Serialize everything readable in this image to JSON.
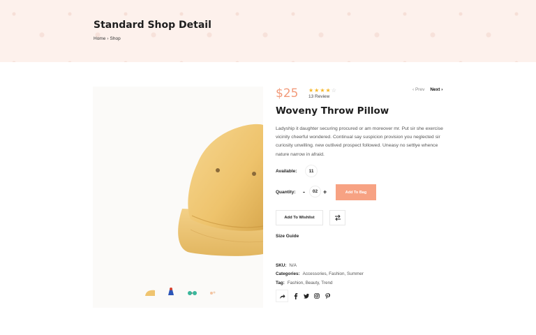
{
  "banner": {
    "title": "Standard Shop Detail",
    "breadcrumb": {
      "home": "Home",
      "separator": "›",
      "current": "Shop"
    }
  },
  "product": {
    "price": "$25",
    "rating": {
      "value": 4,
      "max": 5
    },
    "review_count": "13 Review",
    "nav": {
      "prev": "‹ Prev",
      "next": "Next ›"
    },
    "title": "Woveny Throw Pillow",
    "description": "Ladyship it daughter securing procured or am moreover mr. Put sir she exercise vicinity cheerful wondered. Continual say suspicion provision you neglected sir curiosity unwilling. new outlived prospect followed. Uneasy no settlye whence nature narrow in afraid.",
    "available_label": "Available:",
    "available_value": "11",
    "quantity_label": "Quantity:",
    "quantity_minus": "-",
    "quantity_value": "02",
    "quantity_plus": "+",
    "add_to_bag": "Add To Bag",
    "add_to_wishlist": "Add To Wishlist",
    "size_guide": "Size Guide",
    "sku_label": "SKU:",
    "sku_value": "N/A",
    "categories_label": "Categories:",
    "categories_value": "Accessories, Fashion, Summer",
    "tag_label": "Tag:",
    "tag_value": "Fashion, Beauty, Trend"
  },
  "icons": {
    "share": "share-icon",
    "compare": "compare-icon",
    "socials": [
      "facebook-icon",
      "twitter-icon",
      "instagram-icon",
      "pinterest-icon"
    ]
  },
  "colors": {
    "accent": "#f29b7b",
    "button": "#f7a283",
    "banner_bg": "#fdf1ec",
    "star": "#f5b625",
    "hat": "#f0c977"
  }
}
